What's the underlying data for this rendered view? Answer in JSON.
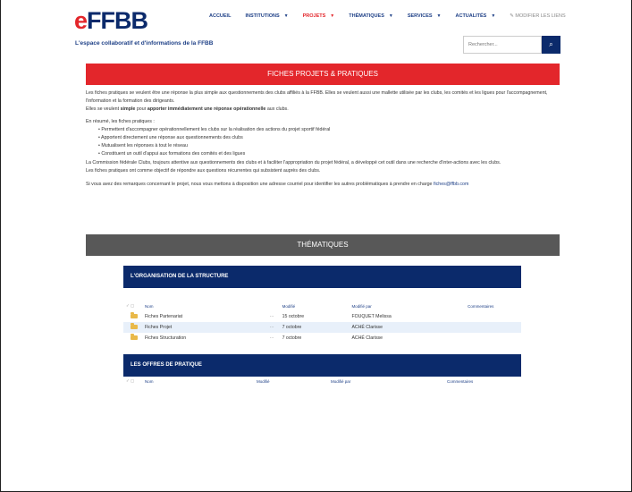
{
  "brand": {
    "e": "e",
    "rest": "FFBB"
  },
  "nav": {
    "items": [
      {
        "label": "ACCUEIL",
        "caret": ""
      },
      {
        "label": "INSTITUTIONS",
        "caret": "▼"
      },
      {
        "label": "PROJETS",
        "caret": "▼"
      },
      {
        "label": "THÉMATIQUES",
        "caret": "▼"
      },
      {
        "label": "SERVICES",
        "caret": "▼"
      },
      {
        "label": "ACTUALITÉS",
        "caret": "▼"
      }
    ],
    "edit_links": "✎ MODIFIER LES LIENS"
  },
  "tagline": "L'espace collaboratif et d'informations de la FFBB",
  "search": {
    "placeholder": "Rechercher...",
    "button_icon": "⌕"
  },
  "banner_fiches": "FICHES PROJETS & PRATIQUES",
  "intro": {
    "p1": "Les fiches pratiques se veulent être une réponse la plus simple aux questionnements des clubs affiliés à la FFBB. Elles se veulent aussi une mallette utilisée par les clubs, les comités et les ligues pour l'accompagnement, l'information et la formation des dirigeants.",
    "p2_a": "Elles se veulent ",
    "p2_b": "simple",
    "p2_c": " pour ",
    "p2_d": "apporter immédiatement une réponse opérationnelle",
    "p2_e": " aux clubs.",
    "summary_title": "En résumé, les fiches pratiques :",
    "bullets": [
      "Permettent d'accompagner opérationnellement les clubs sur la réalisation des actions du projet sportif fédéral",
      "Apportent directement une réponse aux questionnements des clubs",
      "Mutualisent les réponses à tout le réseau",
      "Constituent un outil d'appui aux formations des comités et des ligues"
    ],
    "p3": "La Commission fédérale Clubs, toujours attentive aux questionnements des clubs et à faciliter l'appropriation du projet fédéral, a développé cet outil dans une recherche d'inter-actions avec les clubs.",
    "p4": "Les fiches pratiques ont comme objectif de répondre aux questions récurrentes qui subsistent auprès des clubs.",
    "p5": "Si vous avez des remarques concernant le projet, nous vous mettons à disposition une adresse courriel pour identifier les autres problématiques à prendre en charge",
    "email": "fiches@ffbb.com"
  },
  "banner_thematiques": "THÉMATIQUES",
  "sections": [
    {
      "title": "L'ORGANISATION DE LA STRUCTURE",
      "columns": {
        "check": "✓",
        "type": "▢",
        "name": "Nom",
        "modified": "Modifié",
        "modified_by": "Modifié par",
        "comments": "Commentaires"
      },
      "rows": [
        {
          "name": "Fiches Partenariat",
          "more": "⋯",
          "date": "15 octobre",
          "author": "FOUQUET Melissa"
        },
        {
          "name": "Fiches Projet",
          "more": "⋯",
          "date": "7 octobre",
          "author": "ACHÉ Clarisse"
        },
        {
          "name": "Fiches Structuration",
          "more": "⋯",
          "date": "7 octobre",
          "author": "ACHÉ Clarisse"
        }
      ]
    },
    {
      "title": "LES OFFRES DE PRATIQUE",
      "columns": {
        "check": "✓",
        "type": "▢",
        "name": "Nom",
        "modified": "Modifié",
        "modified_by": "Modifié par",
        "comments": "Commentaires"
      },
      "rows": []
    }
  ],
  "colors": {
    "brand_blue": "#0b2a6b",
    "brand_red": "#e3262b",
    "gray_banner": "#585858"
  }
}
